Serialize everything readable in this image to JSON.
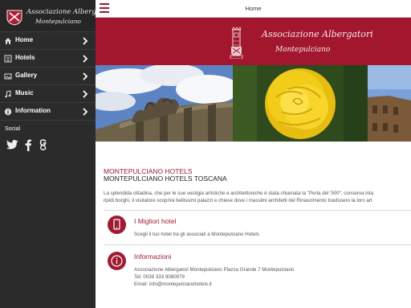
{
  "sidebar": {
    "logo": {
      "line1": "Associazione Albergatori",
      "line2": "Montepulciano"
    },
    "items": [
      {
        "label": "Home",
        "icon": "home-icon"
      },
      {
        "label": "Hotels",
        "icon": "list-icon"
      },
      {
        "label": "Gallery",
        "icon": "gallery-icon"
      },
      {
        "label": "Music",
        "icon": "music-icon"
      },
      {
        "label": "Information",
        "icon": "info-icon"
      }
    ],
    "social": {
      "label": "Social",
      "icons": [
        "twitter-icon",
        "facebook-icon",
        "google-plus-icon"
      ]
    }
  },
  "topbar": {
    "title": "Home"
  },
  "banner": {
    "line1": "Associazione Albergatori",
    "line2": "Montepulciano"
  },
  "content": {
    "headline": "MONTEPULCIANO HOTELS",
    "subheadline": "MONTEPULCIANO HOTELS TOSCANA",
    "intro_line1": "La splendida cittadina, che per le sue vestigia artistiche e architettoniche è stata chiamata la \"Perla del '500\", conserva inta",
    "intro_line2": "ripidi borghi, il visitatore scoprirà bellissimi palazzi e chiese dove i massimi architetti del Rinascimento trasfusero la loro art",
    "cards": [
      {
        "title": "I Migliori hotel",
        "lines": [
          "Scegli il tuo hotel tra gli associati a Montepulciano Hotels"
        ]
      },
      {
        "title": "Informazioni",
        "lines": [
          "Associazione Albergatori Montepulciano Piazza Grande 7 Montepulciano",
          "Tel: 0039 333 9080979",
          "Email: info@montepulcianohotels.it"
        ]
      }
    ]
  },
  "colors": {
    "brand": "#9e1b32",
    "sidebar": "#2b2b2b"
  }
}
